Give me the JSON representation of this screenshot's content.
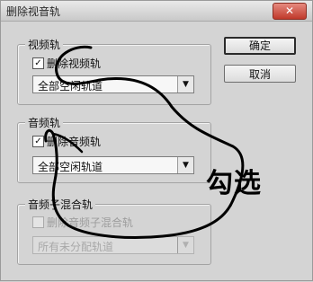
{
  "window": {
    "title": "删除视音轨",
    "close_glyph": "✕"
  },
  "video_group": {
    "title": "视频轨",
    "checkbox_label": "删除视频轨",
    "checked": true,
    "select_value": "全部空闲轨道"
  },
  "audio_group": {
    "title": "音频轨",
    "checkbox_label": "删除音频轨",
    "checked": true,
    "select_value": "全部空闲轨道"
  },
  "submix_group": {
    "title": "音频子混合轨",
    "checkbox_label": "删除音频子混合轨",
    "checked": false,
    "disabled": true,
    "select_value": "所有未分配轨道"
  },
  "buttons": {
    "ok": "确定",
    "cancel": "取消"
  },
  "annotation": {
    "text": "勾选",
    "color": "#000000"
  },
  "icons": {
    "check": "✓",
    "dropdown": "▼"
  }
}
